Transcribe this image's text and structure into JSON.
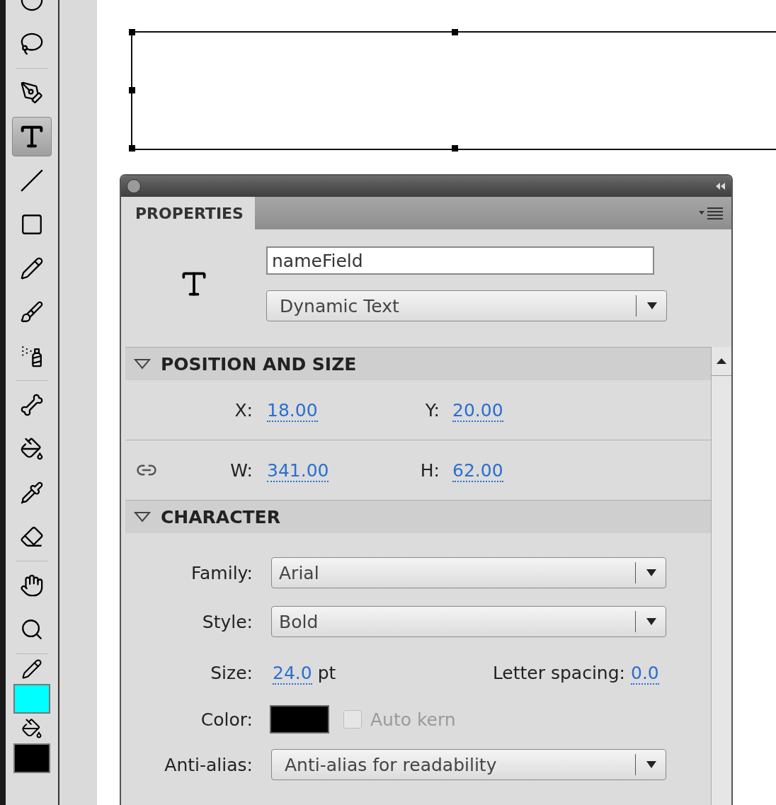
{
  "tools": [
    {
      "kind": "rotate",
      "selected": false
    },
    {
      "kind": "lasso",
      "selected": false
    },
    {
      "kind": "separator"
    },
    {
      "kind": "pen",
      "selected": false
    },
    {
      "kind": "text",
      "selected": true
    },
    {
      "kind": "line",
      "selected": false
    },
    {
      "kind": "rectangle",
      "selected": false
    },
    {
      "kind": "pencil",
      "selected": false
    },
    {
      "kind": "brush",
      "selected": false
    },
    {
      "kind": "spray",
      "selected": false
    },
    {
      "kind": "separator"
    },
    {
      "kind": "bone",
      "selected": false
    },
    {
      "kind": "bucket",
      "selected": false
    },
    {
      "kind": "eyedropper",
      "selected": false
    },
    {
      "kind": "eraser",
      "selected": false
    },
    {
      "kind": "separator"
    },
    {
      "kind": "hand",
      "selected": false
    },
    {
      "kind": "zoom",
      "selected": false
    },
    {
      "kind": "separator"
    },
    {
      "kind": "stroke",
      "color": "#00ffff"
    },
    {
      "kind": "fill",
      "color": "#000000"
    }
  ],
  "panel": {
    "tabs": [
      {
        "label": "PROPERTIES",
        "selected": true
      }
    ],
    "instance_name": "nameField",
    "text_type": "Dynamic Text",
    "sections": [
      {
        "kind": "position",
        "title": "POSITION AND SIZE",
        "expanded": true,
        "rows": [
          [
            {
              "label": "X:",
              "value": "18.00"
            },
            {
              "label": "Y:",
              "value": "20.00"
            }
          ],
          [
            {
              "label": "W:",
              "value": "341.00"
            },
            {
              "label": "H:",
              "value": "62.00"
            }
          ]
        ]
      },
      {
        "kind": "character",
        "title": "CHARACTER",
        "expanded": true,
        "family": {
          "label": "Family:",
          "value": "Arial"
        },
        "style": {
          "label": "Style:",
          "value": "Bold"
        },
        "size": {
          "label": "Size:",
          "value": "24.0",
          "unit": "pt"
        },
        "letter_spacing": {
          "label": "Letter spacing:",
          "value": "0.0"
        },
        "color": {
          "label": "Color:",
          "color": "#000000"
        },
        "auto_kern": {
          "label": "Auto kern",
          "checked": false,
          "disabled": true
        },
        "anti_alias": {
          "label": "Anti-alias:",
          "value": "Anti-alias for readability"
        }
      }
    ]
  }
}
